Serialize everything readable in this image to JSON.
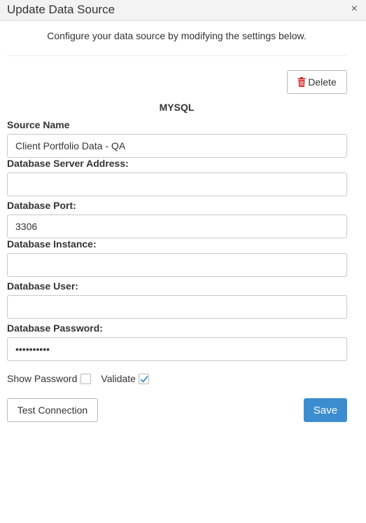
{
  "dialog": {
    "title": "Update Data Source",
    "close_glyph": "×",
    "subtitle": "Configure your data source by modifying the settings below."
  },
  "toolbar": {
    "delete_label": "Delete",
    "delete_icon": "trash-icon",
    "delete_icon_color": "#d9262c"
  },
  "source_type": "MYSQL",
  "fields": {
    "source_name": {
      "label": "Source Name",
      "value": "Client Portfolio Data - QA"
    },
    "server_address": {
      "label": "Database Server Address:",
      "value": ""
    },
    "port": {
      "label": "Database Port:",
      "value": "3306"
    },
    "instance": {
      "label": "Database Instance:",
      "value": ""
    },
    "user": {
      "label": "Database User:",
      "value": ""
    },
    "password": {
      "label": "Database Password:",
      "value": "••••••••••"
    }
  },
  "options": {
    "show_password": {
      "label": "Show Password",
      "checked": false
    },
    "validate": {
      "label": "Validate",
      "checked": true
    }
  },
  "actions": {
    "test_connection_label": "Test Connection",
    "save_label": "Save"
  },
  "colors": {
    "primary": "#3c8dcf",
    "danger": "#d9262c"
  }
}
